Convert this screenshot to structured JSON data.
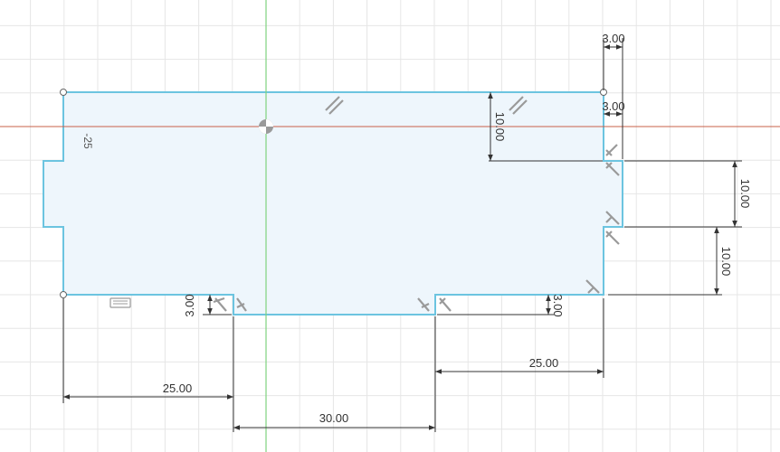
{
  "sketch": {
    "colors": {
      "background": "#ffffff",
      "grid": "#e6e6e6",
      "profile_fill": "#eef6fc",
      "profile_stroke": "#6cc4e0",
      "x_axis": "#c8604a",
      "y_axis": "#7fd37f",
      "dimension": "#333333",
      "constraint_glyph": "#9a9a9a"
    },
    "dimensions": {
      "top_notch_width": "3.00",
      "right_notch_depth": "3.00",
      "right_upper_height": "10.00",
      "right_notch_height": "10.00",
      "right_lower_height": "10.00",
      "bottom_left_notch": "3.00",
      "bottom_right_notch": "3.00",
      "bottom_left_length": "25.00",
      "bottom_center_length": "30.00",
      "bottom_right_length": "25.00"
    },
    "angle_label": "-25"
  }
}
